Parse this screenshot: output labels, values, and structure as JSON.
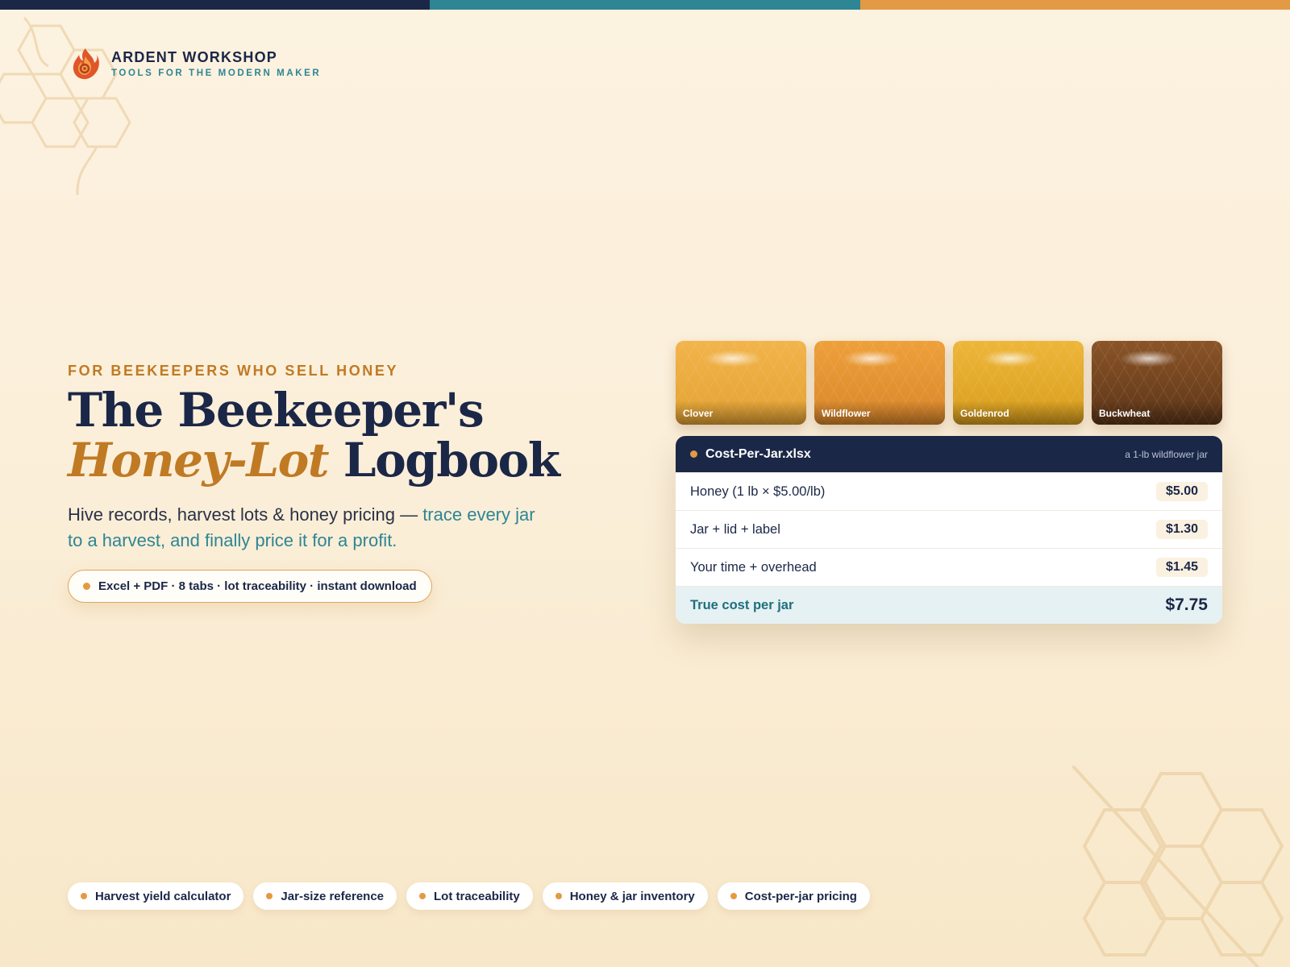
{
  "brand": {
    "name": "ARDENT WORKSHOP",
    "tagline": "TOOLS FOR THE MODERN MAKER"
  },
  "colors": {
    "navy": "#1b2747",
    "teal": "#2e8594",
    "amber": "#e39a44",
    "honey": "#c07a24",
    "background": "#fcf2e0"
  },
  "topbar": [
    "#1b2747",
    "#2e8594",
    "#e39a44"
  ],
  "hero": {
    "eyebrow": "FOR BEEKEEPERS WHO SELL HONEY",
    "title_line1": "The Beekeeper's",
    "title_italic": "Honey-Lot",
    "title_rest": " Logbook",
    "subtitle_plain": "Hive records, harvest lots & honey pricing — ",
    "subtitle_accent": "trace every jar to a harvest, and finally price it for a profit.",
    "pill": "Excel + PDF · 8 tabs · lot traceability · instant download"
  },
  "swatches": [
    {
      "label": "Clover",
      "color_top": "#f2b44b",
      "color_bottom": "#e3a233"
    },
    {
      "label": "Wildflower",
      "color_top": "#eea03a",
      "color_bottom": "#d9862a"
    },
    {
      "label": "Goldenrod",
      "color_top": "#eeb63a",
      "color_bottom": "#d89d1c"
    },
    {
      "label": "Buckwheat",
      "color_top": "#8a5427",
      "color_bottom": "#5c3518"
    }
  ],
  "sheet": {
    "filename": "Cost-Per-Jar.xlsx",
    "note": "a 1-lb wildflower jar",
    "rows": [
      {
        "label": "Honey (1 lb × $5.00/lb)",
        "value": "$5.00"
      },
      {
        "label": "Jar + lid + label",
        "value": "$1.30"
      },
      {
        "label": "Your time + overhead",
        "value": "$1.45"
      }
    ],
    "total": {
      "label": "True cost per jar",
      "value": "$7.75"
    }
  },
  "features": [
    "Harvest yield calculator",
    "Jar-size reference",
    "Lot traceability",
    "Honey & jar inventory",
    "Cost-per-jar pricing"
  ]
}
